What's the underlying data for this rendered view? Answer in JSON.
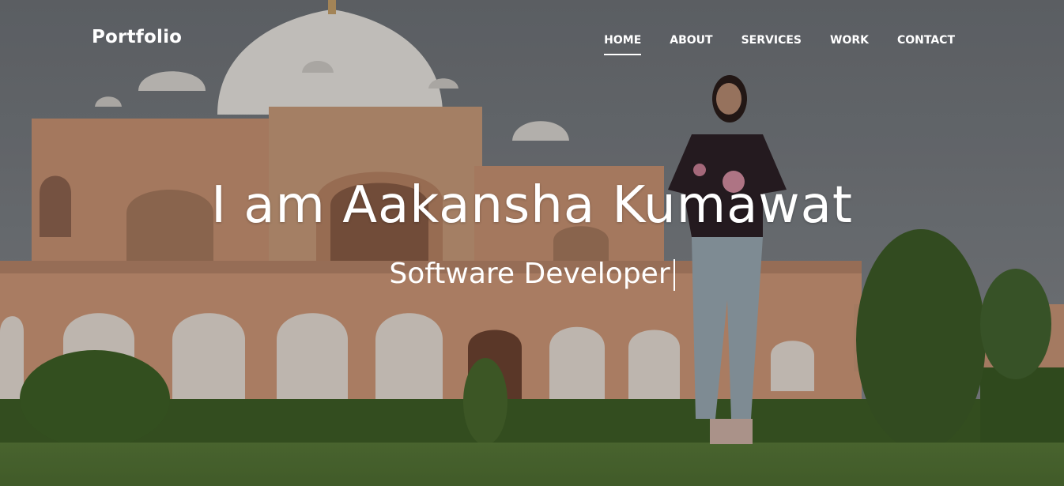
{
  "nav": {
    "brand": "Portfolio",
    "links": [
      "HOME",
      "ABOUT",
      "SERVICES",
      "WORK",
      "CONTACT"
    ],
    "active": "HOME"
  },
  "hero": {
    "title": "I am Aakansha Kumawat",
    "subtitle": "Software Developer",
    "background": {
      "description": "Humayun's Tomb in red sandstone and white marble, lawn and hedges in front, woman standing on the right",
      "sky_color": "#7b7f85",
      "stone_color": "#c98f6a",
      "grass_color": "#5c7a3a"
    }
  },
  "colors": {
    "text": "#ffffff",
    "overlay": "rgba(0,0,0,0.18)"
  }
}
